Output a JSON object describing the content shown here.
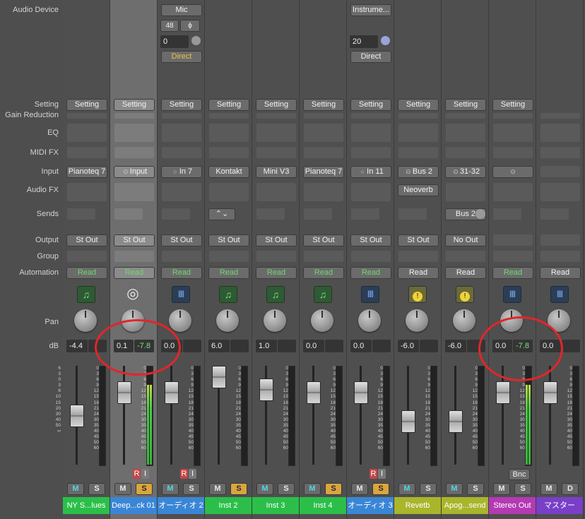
{
  "row_labels": {
    "audio_device": "Audio Device",
    "setting": "Setting",
    "gain_reduction": "Gain Reduction",
    "eq": "EQ",
    "midi_fx": "MIDI FX",
    "input": "Input",
    "audio_fx": "Audio FX",
    "sends": "Sends",
    "output": "Output",
    "group": "Group",
    "automation": "Automation",
    "pan": "Pan",
    "db": "dB"
  },
  "scale_left": [
    "6",
    "3",
    "0",
    "3",
    "6",
    "10",
    "15",
    "20",
    "30",
    "40",
    "50",
    "∞"
  ],
  "scale_right": [
    "0",
    "3",
    "6",
    "9",
    "12",
    "15",
    "18",
    "21",
    "24",
    "30",
    "35",
    "40",
    "45",
    "50",
    "60"
  ],
  "strips": [
    {
      "name": "NY S...lues",
      "color": "#2bbf4a",
      "setting": "Setting",
      "input": "Pianoteq 7",
      "output": "St Out",
      "automation": "Read",
      "icon": "music-note-icon",
      "icon_glyph": "♫",
      "db": "-4.4",
      "pan": "",
      "mute": "M",
      "solo": "S",
      "mute_cyan": true,
      "solo_on": false,
      "fader": 0.6
    },
    {
      "name": "Deep...ck 01",
      "color": "#3a86d6",
      "setting": "Setting",
      "input": "Input",
      "output": "St Out",
      "automation": "Read",
      "icon": "dial-icon",
      "icon_glyph": "◎",
      "db": "0.1",
      "peak": "-7.8",
      "mute": "M",
      "solo": "S",
      "mute_cyan": false,
      "solo_on": true,
      "rec": "R",
      "inp": "I",
      "fader": 0.82,
      "selected": true
    },
    {
      "name": "オーディオ 2",
      "color": "#3a86d6",
      "setting": "Setting",
      "mic": "Mic",
      "format": "48",
      "phase": "ϕ",
      "gain": "0",
      "direct": "Direct",
      "input": "In 7",
      "output": "St Out",
      "automation": "Read",
      "icon": "waveform-icon",
      "icon_glyph": "|||||",
      "db": "0.0",
      "mute": "M",
      "solo": "S",
      "mute_cyan": true,
      "solo_on": false,
      "rec": "R",
      "inp": "I",
      "fader": 0.82
    },
    {
      "name": "Inst 2",
      "color": "#2bbf4a",
      "setting": "Setting",
      "input": "Kontakt",
      "output": "St Out",
      "automation": "Read",
      "icon": "music-note-icon",
      "icon_glyph": "♫",
      "db": "6.0",
      "mute": "M",
      "solo": "S",
      "mute_cyan": false,
      "solo_on": true,
      "fader": 0.97
    },
    {
      "name": "Inst 3",
      "color": "#2bbf4a",
      "setting": "Setting",
      "input": "Mini V3",
      "output": "St Out",
      "automation": "Read",
      "icon": "music-note-icon",
      "icon_glyph": "♫",
      "db": "1.0",
      "mute": "M",
      "solo": "S",
      "mute_cyan": true,
      "solo_on": false,
      "fader": 0.85
    },
    {
      "name": "Inst 4",
      "color": "#2bbf4a",
      "setting": "Setting",
      "input": "Pianoteq 7",
      "output": "St Out",
      "automation": "Read",
      "icon": "music-note-icon",
      "icon_glyph": "♫",
      "db": "0.0",
      "mute": "M",
      "solo": "S",
      "mute_cyan": true,
      "solo_on": true,
      "fader": 0.82
    },
    {
      "name": "オーディオ 3",
      "color": "#3a86d6",
      "setting": "Setting",
      "instrument": "Instrume...",
      "gain": "20",
      "direct": "Direct",
      "input": "In 11",
      "output": "St Out",
      "automation": "Read",
      "icon": "waveform-icon",
      "icon_glyph": "|||||",
      "db": "0.0",
      "mute": "M",
      "solo": "S",
      "mute_cyan": false,
      "solo_on": true,
      "rec": "R",
      "inp": "I",
      "fader": 0.82
    },
    {
      "name": "Revetb",
      "color": "#a9b52a",
      "setting": "Setting",
      "input": "Bus 2",
      "audio_fx": "Neoverb",
      "output": "St Out",
      "automation": "Read",
      "icon": "clock-icon",
      "icon_glyph": "!",
      "db": "-6.0",
      "mute": "M",
      "solo": "S",
      "mute_cyan": true,
      "solo_on": false,
      "fader": 0.55,
      "auto_plain": true
    },
    {
      "name": "Apog...send",
      "color": "#a9b52a",
      "setting": "Setting",
      "input": "31-32",
      "send": "Bus 2",
      "output": "No Out",
      "automation": "Read",
      "icon": "clock-icon",
      "icon_glyph": "!",
      "db": "-6.0",
      "mute": "M",
      "solo": "S",
      "mute_cyan": true,
      "solo_on": false,
      "fader": 0.55,
      "auto_plain": true
    },
    {
      "name": "Stereo Out",
      "color": "#b43ab4",
      "setting": "Setting",
      "input": "",
      "automation": "Read",
      "icon": "waveform-icon",
      "icon_glyph": "|||||",
      "db": "0.0",
      "peak": "-7.8",
      "mute": "M",
      "solo": "S",
      "mute_cyan": false,
      "solo_on": false,
      "bnc": "Bnc",
      "fader": 0.82
    },
    {
      "name": "マスター",
      "color": "#7a3fc9",
      "automation": "Read",
      "icon": "waveform-icon",
      "icon_glyph": "|||||",
      "db": "0.0",
      "mute": "M",
      "solo": "D",
      "mute_cyan": false,
      "solo_on": false,
      "fader": 0.82,
      "auto_plain": true
    }
  ]
}
